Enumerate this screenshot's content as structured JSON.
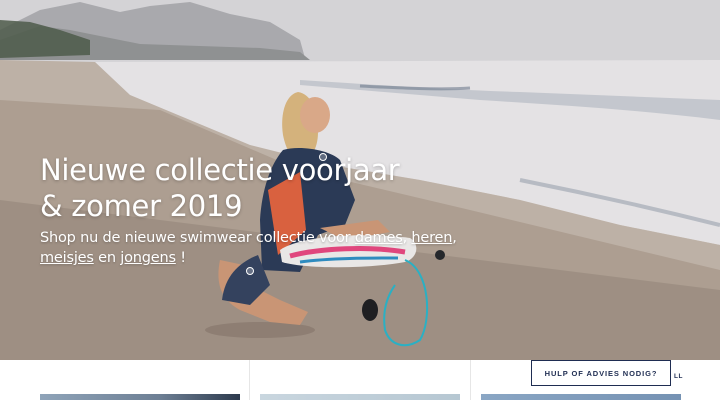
{
  "hero": {
    "title_line1": "Nieuwe collectie voorjaar",
    "title_line2": "& zomer 2019",
    "subtitle_prefix": "Shop nu de nieuwe swimwear collectie voor ",
    "link_dames": "dames",
    "sep1": ", ",
    "link_heren": "heren",
    "sep2": ",",
    "link_meisjes": "meisjes",
    "sep3": " en ",
    "link_jongens": "jongens",
    "subtitle_suffix": " !"
  },
  "help": {
    "label": "HULP OF ADVIES NODIG?",
    "partial_text": "LL"
  },
  "colors": {
    "navy": "#1f2d52",
    "white": "#ffffff"
  }
}
